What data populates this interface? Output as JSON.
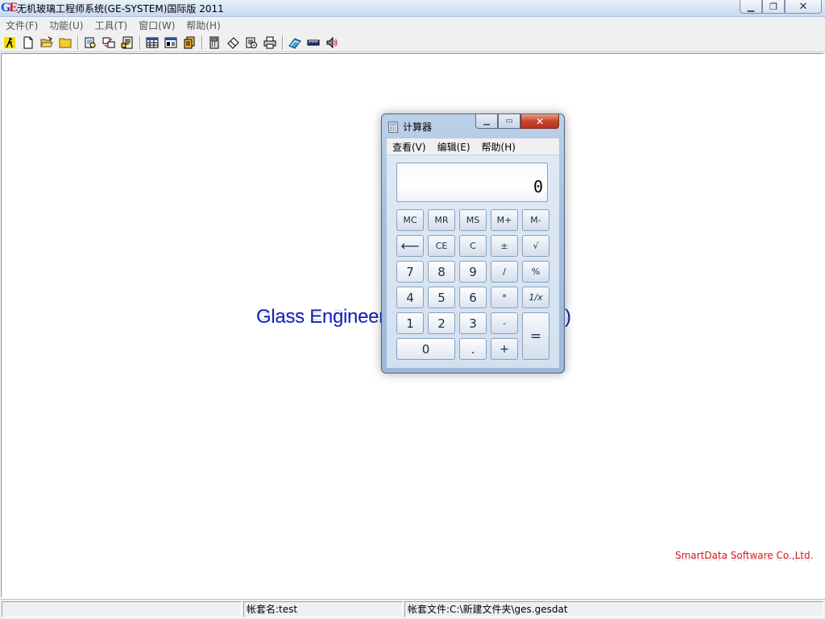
{
  "app": {
    "logo": "GE",
    "title": "无机玻璃工程师系统(GE-SYSTEM)国际版 2011",
    "window_buttons": [
      "minimize",
      "restore",
      "close"
    ]
  },
  "menu": [
    "文件(F)",
    "功能(U)",
    "工具(T)",
    "窗口(W)",
    "帮助(H)"
  ],
  "toolbar": {
    "groups": [
      [
        "run-icon",
        "new-file-icon",
        "open-folder-icon",
        "folder-icon"
      ],
      [
        "query-icon",
        "transfer-icon",
        "report-icon"
      ],
      [
        "table-icon",
        "grid-icon",
        "stack-icon"
      ],
      [
        "calculator-icon",
        "eraser-icon",
        "scan-icon",
        "print-icon"
      ],
      [
        "book-icon",
        "ruler-icon",
        "speaker-icon"
      ]
    ]
  },
  "workspace": {
    "splash_text": "Glass Engineer",
    "splash_suffix": ")",
    "company": "SmartData Software Co.,Ltd."
  },
  "statusbar": {
    "panel1": "",
    "account_name": "帐套名:test",
    "account_file": "帐套文件:C:\\新建文件夹\\ges.gesdat"
  },
  "calculator": {
    "title": "计算器",
    "menu": [
      "查看(V)",
      "编辑(E)",
      "帮助(H)"
    ],
    "display": "0",
    "keys": {
      "mc": "MC",
      "mr": "MR",
      "ms": "MS",
      "mplus": "M+",
      "mminus": "M-",
      "backspace": "⟵",
      "ce": "CE",
      "c": "C",
      "plusminus": "±",
      "sqrt": "√",
      "n7": "7",
      "n8": "8",
      "n9": "9",
      "div": "/",
      "percent": "%",
      "n4": "4",
      "n5": "5",
      "n6": "6",
      "mul": "*",
      "recip": "1/x",
      "n1": "1",
      "n2": "2",
      "n3": "3",
      "minus": "-",
      "equals": "=",
      "n0": "0",
      "dot": ".",
      "plus": "+"
    }
  }
}
